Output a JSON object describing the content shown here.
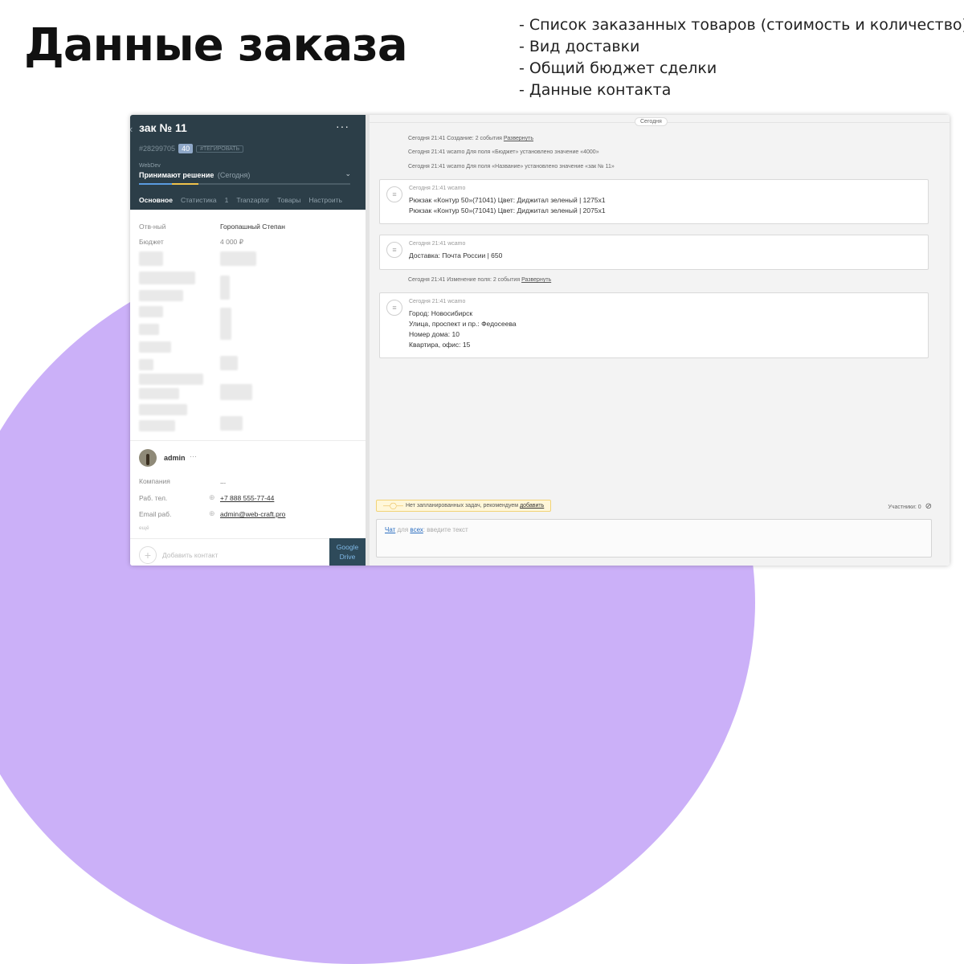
{
  "slide": {
    "title": "Данные заказа",
    "bullets": [
      "- Список заказанных товаров (стоимость и количество)",
      "- Вид доставки",
      "- Общий бюджет сделки",
      "- Данные контакта"
    ]
  },
  "lead": {
    "name": "зак № 11",
    "menu": "···",
    "id": "#28299705",
    "id_badge": "40",
    "tag_button": "#ТЕГИРОВАТЬ",
    "pipeline": "WebDev",
    "stage": "Принимают решение",
    "stage_date": "(Сегодня)",
    "progress": 0.28,
    "tabs": [
      "Основное",
      "Статистика",
      "1",
      "Tranzaptor",
      "Товары",
      "Настроить"
    ],
    "fields": [
      {
        "label": "Отв-ный",
        "value": "Горопашный Степан"
      },
      {
        "label": "Бюджет",
        "value": "4 000 ₽"
      }
    ],
    "contact": {
      "name": "admin",
      "menu": "···",
      "company_label": "Компания",
      "company_value": "...",
      "phone_label": "Раб. тел.",
      "phone_value": "+7 888 555-77-44",
      "email_label": "Email раб.",
      "email_value": "admin@web-craft.pro",
      "more": "ещё"
    },
    "add_contact": "Добавить контакт",
    "google_drive": "Google Drive"
  },
  "feed": {
    "today": "Сегодня",
    "sys1": {
      "text": "Сегодня 21:41 Создание: 2 события ",
      "link": "Развернуть"
    },
    "sys2": "Сегодня 21:41 wcamo  Для поля «Бюджет» установлено значение «4000»",
    "sys3": "Сегодня 21:41 wcamo  Для поля «Название» установлено значение «зак № 11»",
    "note1": {
      "meta": "Сегодня 21:41 wcamo",
      "lines": [
        "Рюкзак «Контур 50»(71041) Цвет: Диджитал зеленый | 1275x1",
        "Рюкзак «Контур 50»(71041) Цвет: Диджитал зеленый | 2075x1"
      ]
    },
    "note2": {
      "meta": "Сегодня 21:41 wcamo",
      "lines": [
        "Доставка: Почта России | 650"
      ]
    },
    "sys4": {
      "text": "Сегодня 21:41 Изменение поля: 2 события ",
      "link": "Развернуть"
    },
    "note3": {
      "meta": "Сегодня 21:41 wcamo",
      "lines": [
        "Город: Новосибирск",
        "Улица, проспект и пр.: Федосеева",
        "Номер дома: 10",
        "Квартира, офис: 15"
      ]
    },
    "task": {
      "text": "Нет запланированных задач, рекомендуем ",
      "link": "добавить"
    },
    "participants": "Участники: 0",
    "chat": {
      "chat": "Чат",
      "for": "для",
      "all": "всех",
      "placeholder": ": введите текст"
    }
  }
}
